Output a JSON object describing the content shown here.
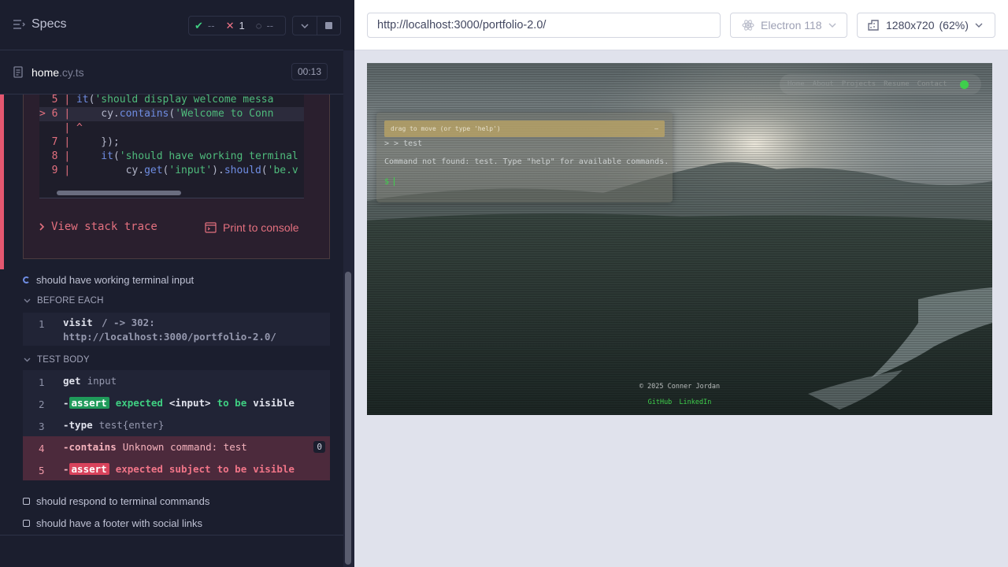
{
  "reporter": {
    "specs_label": "Specs",
    "stats": {
      "passed": "--",
      "failed": "1",
      "pending": "--"
    },
    "spec": {
      "name": "home",
      "ext": ".cy.ts",
      "duration": "00:13"
    },
    "code_frame": {
      "lines": [
        {
          "num": "5",
          "marker": " ",
          "text": "    it('should display welcome messa"
        },
        {
          "num": "6",
          "marker": ">",
          "text": "        cy.contains('Welcome to Conn"
        },
        {
          "num": "",
          "marker": " ",
          "text": "      ^"
        },
        {
          "num": "7",
          "marker": " ",
          "text": "    });"
        },
        {
          "num": "8",
          "marker": " ",
          "text": "    it('should have working terminal"
        },
        {
          "num": "9",
          "marker": " ",
          "text": "        cy.get('input').should('be.v"
        }
      ]
    },
    "view_stack_trace": "View stack trace",
    "print_to_console": "Print to console",
    "running_test": "should have working terminal input",
    "before_each_label": "BEFORE EACH",
    "visit_cmd": {
      "num": "1",
      "name": "visit",
      "msg_line1": "/ -> 302:",
      "msg_line2": "http://localhost:3000/portfolio-2.0/"
    },
    "test_body_label": "TEST BODY",
    "commands": [
      {
        "num": "1",
        "name": "get",
        "msg": "input"
      },
      {
        "num": "2",
        "name": "assert",
        "msg": "expected <input> to be visible"
      },
      {
        "num": "3",
        "name": "type",
        "msg": "test{enter}"
      },
      {
        "num": "4",
        "name": "contains",
        "msg": "Unknown command: test",
        "count": "0"
      },
      {
        "num": "5",
        "name": "assert",
        "msg": "expected subject to be visible"
      }
    ],
    "assert_parts": {
      "expected": "expected",
      "input": "<input>",
      "to_be": "to be",
      "visible": "visible",
      "subject": "subject"
    },
    "pending_tests": [
      "should respond to terminal commands",
      "should have a footer with social links"
    ]
  },
  "aut": {
    "url": "http://localhost:3000/portfolio-2.0/",
    "browser": "Electron 118",
    "viewport": "1280x720",
    "scale": "(62%)",
    "app": {
      "nav": [
        "Home",
        "About",
        "Projects",
        "Resume",
        "Contact"
      ],
      "terminal_title": "drag to move (or type 'help')",
      "terminal_min": "—",
      "terminal_echo": "> > test",
      "terminal_error": "Command not found: test. Type \"help\" for available commands.",
      "terminal_prompt": "$",
      "footer_copy": "© 2025 Conner Jordan",
      "footer_links": [
        "GitHub",
        "LinkedIn"
      ]
    }
  },
  "colors": {
    "fail": "#e45770",
    "pass": "#1f9a5a",
    "accent_green": "#3fcf4c"
  }
}
